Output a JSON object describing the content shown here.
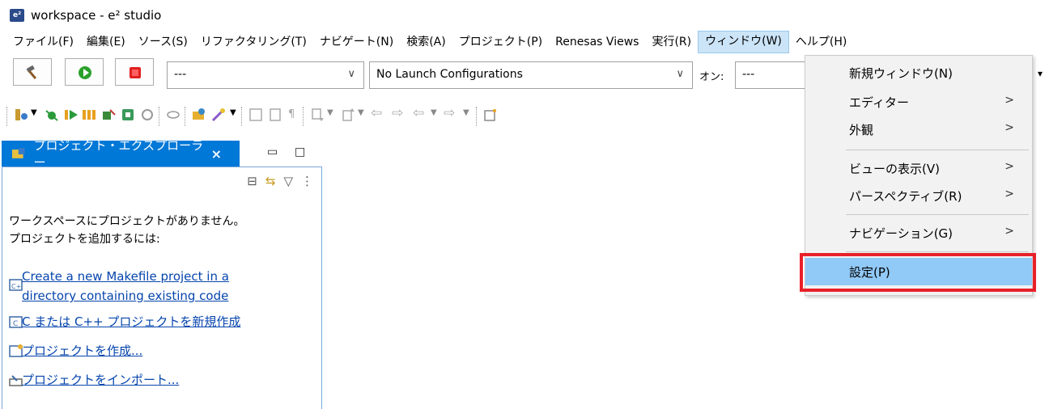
{
  "window": {
    "title": "workspace - e² studio",
    "logo_text": "e²"
  },
  "menubar": [
    "ファイル(F)",
    "編集(E)",
    "ソース(S)",
    "リファクタリング(T)",
    "ナビゲート(N)",
    "検索(A)",
    "プロジェクト(P)",
    "Renesas Views",
    "実行(R)",
    "ウィンドウ(W)",
    "ヘルプ(H)"
  ],
  "toolbar": {
    "combo1_value": "---",
    "combo2_value": "No Launch Configurations",
    "on_label": "オン:",
    "combo3_value": "---"
  },
  "project_explorer": {
    "tab_label": "プロジェクト・エクスプローラー",
    "close_glyph": "×",
    "empty_message": "ワークスペースにプロジェクトがありません。\nプロジェクトを追加するには:",
    "links": [
      "Create a new Makefile project in a",
      "directory containing existing code",
      "C または C++ プロジェクトを新規作成",
      "プロジェクトを作成...",
      "プロジェクトをインポート..."
    ]
  },
  "window_menu": {
    "items": [
      {
        "label": "新規ウィンドウ(N)",
        "arrow": ""
      },
      {
        "label": "エディター",
        "arrow": ">"
      },
      {
        "label": "外観",
        "arrow": ">"
      },
      {
        "label": "ビューの表示(V)",
        "arrow": ">"
      },
      {
        "label": "パースペクティブ(R)",
        "arrow": ">"
      },
      {
        "label": "ナビゲーション(G)",
        "arrow": ">"
      },
      {
        "label": "設定(P)",
        "arrow": ""
      }
    ]
  },
  "colors": {
    "accent": "#0078d7",
    "menu_highlight": "#91c9f7",
    "annotation": "#e8202a",
    "link": "#0645ad"
  }
}
